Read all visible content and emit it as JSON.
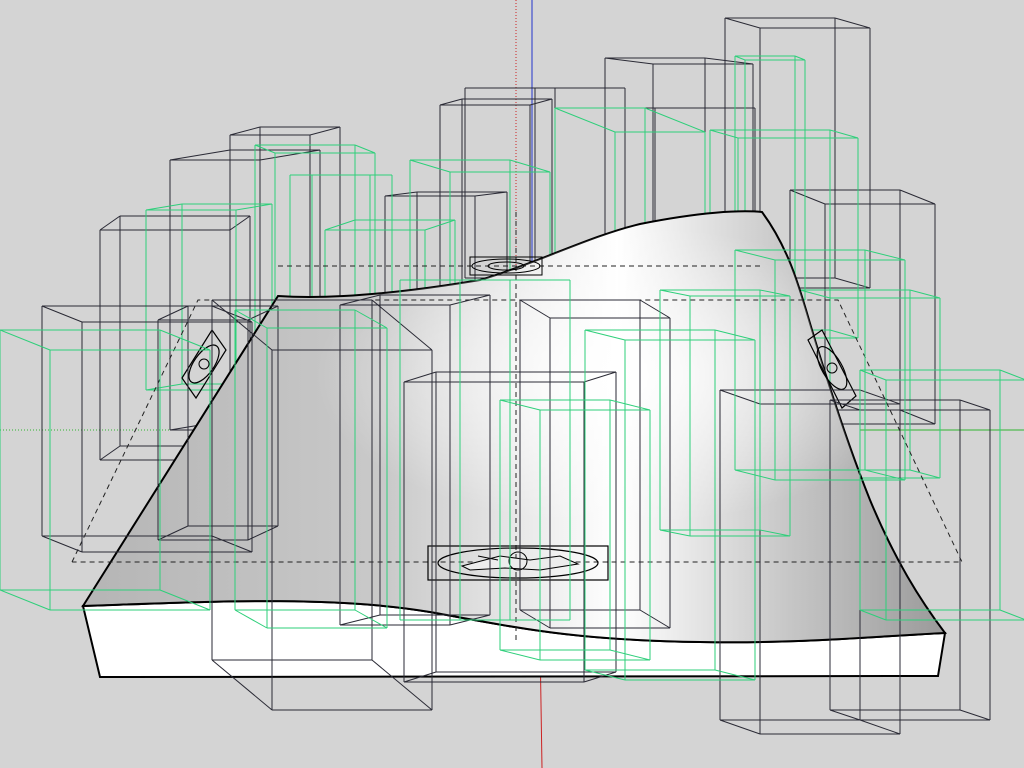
{
  "viewport": {
    "background": "#d4d4d4",
    "colors": {
      "black_box": "#2a2a35",
      "green_box": "#2ecf7a",
      "axis_red": "#cc2222",
      "axis_green": "#2fb52f",
      "axis_blue": "#2233cc",
      "terrain_edge": "#000000"
    }
  },
  "scene": {
    "axes": [
      "red-axis",
      "green-axis",
      "blue-axis"
    ],
    "terrain": "terrain-slab",
    "markers": [
      "marker-front",
      "marker-back",
      "marker-left",
      "marker-right"
    ]
  }
}
